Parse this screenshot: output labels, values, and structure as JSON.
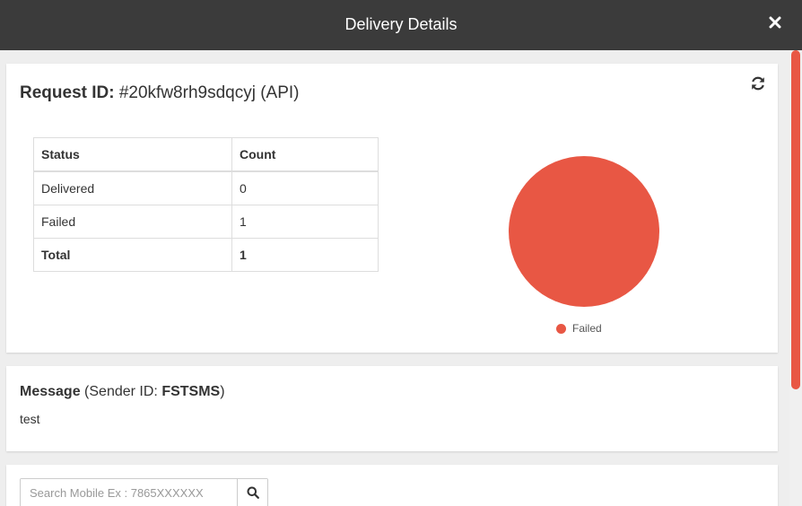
{
  "modal": {
    "title": "Delivery Details",
    "close_icon": "close-icon"
  },
  "request": {
    "label": "Request ID:",
    "value": "#20kfw8rh9sdqcyj (API)",
    "refresh_icon": "refresh-icon"
  },
  "status_table": {
    "headers": [
      "Status",
      "Count"
    ],
    "rows": [
      {
        "status": "Delivered",
        "count": "0"
      },
      {
        "status": "Failed",
        "count": "1"
      },
      {
        "status": "Total",
        "count": "1"
      }
    ]
  },
  "chart_data": {
    "type": "pie",
    "categories": [
      "Delivered",
      "Failed"
    ],
    "values": [
      0,
      1
    ],
    "colors": [
      "#5cb85c",
      "#e85744"
    ],
    "legend": [
      "Failed"
    ],
    "legend_placement": "bottom"
  },
  "message": {
    "label": "Message",
    "sender_prefix": "(Sender ID: ",
    "sender_id": "FSTSMS",
    "sender_suffix": ")",
    "body": "test"
  },
  "search": {
    "placeholder": "Search Mobile Ex : 7865XXXXXX",
    "value": "",
    "search_icon": "search-icon"
  },
  "colors": {
    "header_bg": "#3b3b3b",
    "accent": "#e85744"
  }
}
